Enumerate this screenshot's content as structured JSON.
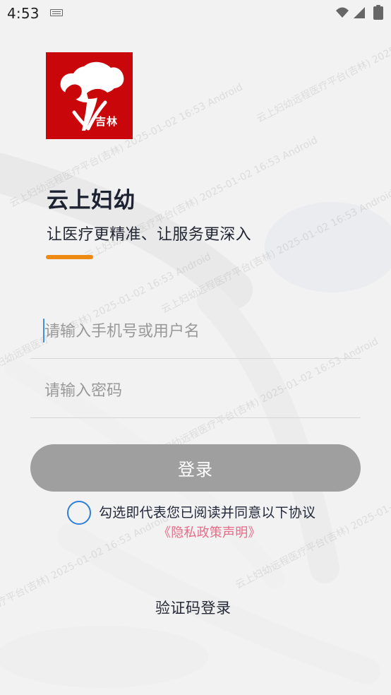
{
  "status_bar": {
    "time": "4:53"
  },
  "app": {
    "logo_text": "吉林",
    "title": "云上妇幼",
    "subtitle": "让医疗更精准、让服务更深入"
  },
  "form": {
    "username_placeholder": "请输入手机号或用户名",
    "password_placeholder": "请输入密码",
    "login_label": "登录"
  },
  "agreement": {
    "text": "勾选即代表您已阅读并同意以下协议",
    "privacy_label": "《隐私政策声明》"
  },
  "alternative_login": {
    "label": "验证码登录"
  },
  "watermark": {
    "text": "云上妇幼远程医疗平台(吉林) 2025-01-02 16:53 Android"
  },
  "colors": {
    "logo_red": "#c9070b",
    "accent_orange": "#ee8a12",
    "checkbox_blue": "#2f7fd8",
    "privacy_pink": "#e86b87",
    "login_gray": "#9f9f9f"
  },
  "icons": [
    "keyboard-icon",
    "wifi-icon",
    "signal-icon",
    "battery-icon",
    "logo-icon"
  ]
}
